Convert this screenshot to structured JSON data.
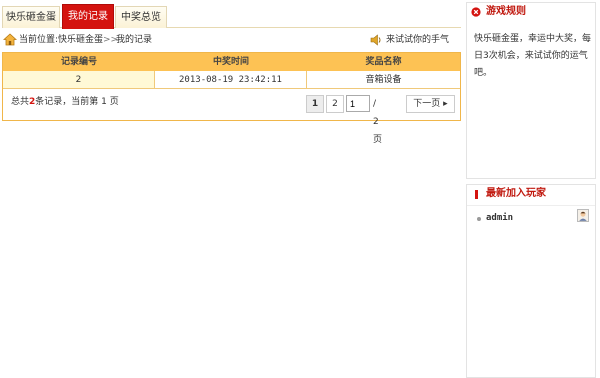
{
  "tabs": [
    {
      "label": "快乐砸金蛋"
    },
    {
      "label": "我的记录"
    },
    {
      "label": "中奖总览"
    }
  ],
  "breadcrumb": {
    "label": "当前位置:快乐砸金蛋",
    "separator": ">>",
    "current": "我的记录",
    "tip": "来试试你的手气吧!"
  },
  "table": {
    "headers": [
      "记录编号",
      "中奖时间",
      "奖品名称"
    ],
    "rows": [
      [
        "2",
        "2013-08-19 23:42:11",
        "音箱设备"
      ]
    ]
  },
  "summary": {
    "prefix": "总共",
    "count": "2",
    "suffix": "条记录，当前第 1 页"
  },
  "pager": {
    "page1": "1",
    "page2": "2",
    "input_value": "1",
    "total": "/ 2 页",
    "next": "下一页 ▸"
  },
  "rules_panel": {
    "title": "游戏规则",
    "text": "快乐砸金蛋，幸运中大奖，每日3次机会，来试试你的运气吧。"
  },
  "players_panel": {
    "title": "最新加入玩家",
    "players": [
      {
        "name": "admin"
      }
    ]
  },
  "colors": {
    "accent_red": "#d4130f",
    "table_header": "#fdc254",
    "table_border": "#f0b64a"
  }
}
